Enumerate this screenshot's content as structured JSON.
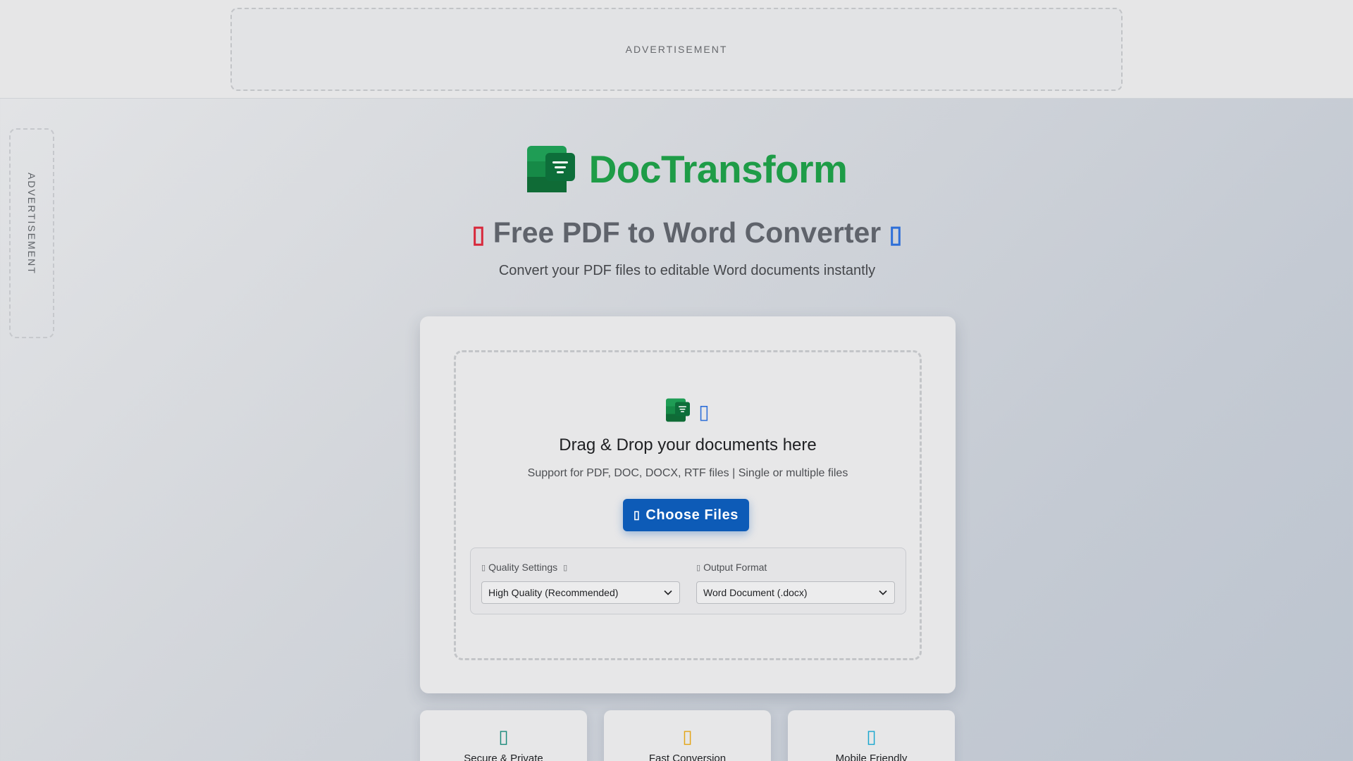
{
  "ads": {
    "top_label": "ADVERTISEMENT",
    "side_label": "ADVERTISEMENT"
  },
  "brand": {
    "name": "DocTransform",
    "color": "#1e9c47"
  },
  "hero": {
    "title": "Free PDF to Word Converter",
    "subtitle": "Convert your PDF files to editable Word documents instantly",
    "left_icon": "pdf-file-icon",
    "right_icon": "word-file-icon"
  },
  "upload": {
    "title": "Drag & Drop your documents here",
    "support": "Support for PDF, DOC, DOCX, RTF files | Single or multiple files",
    "button_label": "Choose Files",
    "button_color": "#0d5bb7"
  },
  "settings": {
    "quality": {
      "label": "Quality Settings",
      "selected": "High Quality (Recommended)"
    },
    "format": {
      "label": "Output Format",
      "selected": "Word Document (.docx)"
    }
  },
  "features": [
    {
      "label": "Secure & Private",
      "icon": "shield-icon",
      "color": "#1a8a7a"
    },
    {
      "label": "Fast Conversion",
      "icon": "bolt-icon",
      "color": "#e3a516"
    },
    {
      "label": "Mobile Friendly",
      "icon": "mobile-icon",
      "color": "#1aa7cf"
    }
  ]
}
